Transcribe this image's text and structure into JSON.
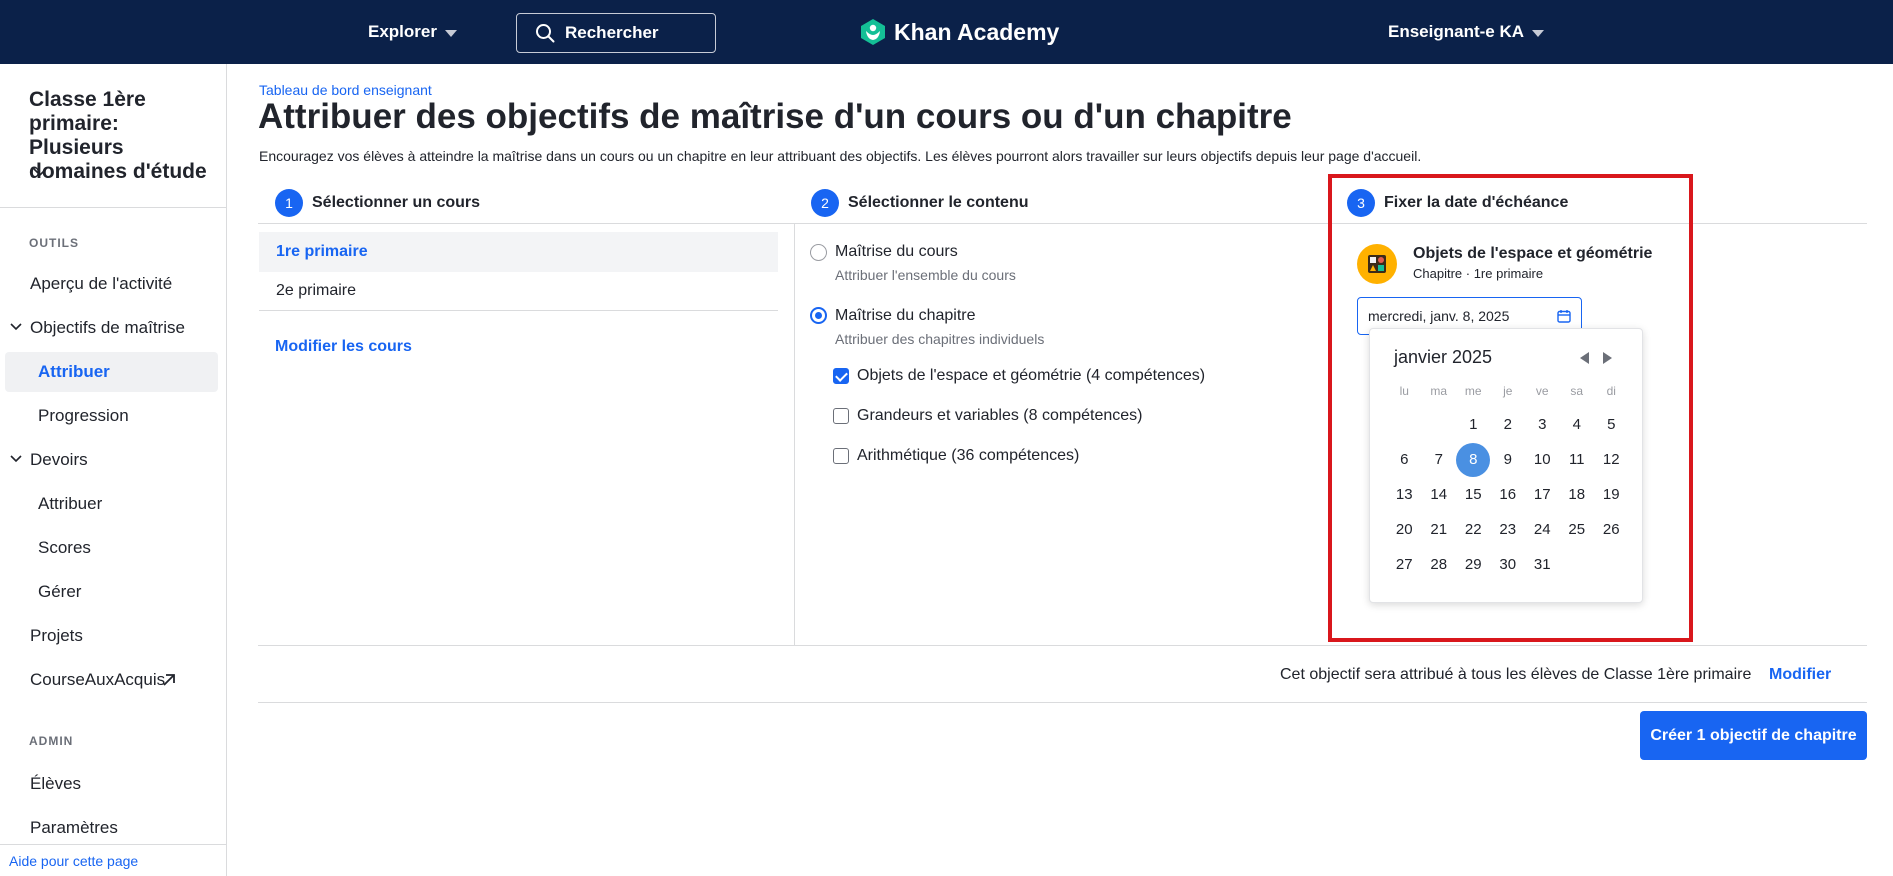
{
  "nav": {
    "explore": "Explorer",
    "search_placeholder": "Rechercher",
    "logo_text": "Khan Academy",
    "user": "Enseignant-e KA",
    "bg_color": "#0b2149"
  },
  "sidebar": {
    "class_title": "Classe 1ère primaire: Plusieurs domaines d'étude",
    "tools_label": "OUTILS",
    "admin_label": "ADMIN",
    "items": [
      {
        "label": "Aperçu de l'activité"
      },
      {
        "label": "Objectifs de maîtrise"
      },
      {
        "label": "Attribuer"
      },
      {
        "label": "Progression"
      },
      {
        "label": "Devoirs"
      },
      {
        "label": "Attribuer"
      },
      {
        "label": "Scores"
      },
      {
        "label": "Gérer"
      },
      {
        "label": "Projets"
      },
      {
        "label": "CourseAuxAcquis"
      },
      {
        "label": "Élèves"
      },
      {
        "label": "Paramètres"
      }
    ],
    "help": "Aide pour cette page"
  },
  "main": {
    "breadcrumb": "Tableau de bord enseignant",
    "title": "Attribuer des objectifs de maîtrise d'un cours ou d'un chapitre",
    "description": "Encouragez vos élèves à atteindre la maîtrise dans un cours ou un chapitre en leur attribuant des objectifs. Les élèves pourront alors travailler sur leurs objectifs depuis leur page d'accueil.",
    "steps": [
      {
        "num": "1",
        "label": "Sélectionner un cours"
      },
      {
        "num": "2",
        "label": "Sélectionner le contenu"
      },
      {
        "num": "3",
        "label": "Fixer la date d'échéance"
      }
    ],
    "courses": [
      "1re primaire",
      "2e primaire"
    ],
    "modify_courses": "Modifier les cours",
    "content": {
      "course_mastery": {
        "label": "Maîtrise du cours",
        "sub": "Attribuer l'ensemble du cours"
      },
      "chapter_mastery": {
        "label": "Maîtrise du chapitre",
        "sub": "Attribuer des chapitres individuels"
      },
      "chapters": [
        {
          "label": "Objets de l'espace et géométrie (4 compétences)",
          "checked": true
        },
        {
          "label": "Grandeurs et variables (8 compétences)",
          "checked": false
        },
        {
          "label": "Arithmétique (36 compétences)",
          "checked": false
        }
      ]
    },
    "due": {
      "chapter_name": "Objets de l'espace et géométrie",
      "chapter_sub": "Chapitre · 1re primaire",
      "date_value": "mercredi, janv. 8, 2025",
      "calendar": {
        "month": "janvier 2025",
        "weekdays": [
          "lu",
          "ma",
          "me",
          "je",
          "ve",
          "sa",
          "di"
        ],
        "leading_blanks": 2,
        "days": 31,
        "selected": 8
      }
    },
    "footer": {
      "assign_note": "Cet objectif sera attribué à tous les élèves de Classe 1ère primaire",
      "modify": "Modifier",
      "create_button": "Créer 1 objectif de chapitre"
    }
  }
}
